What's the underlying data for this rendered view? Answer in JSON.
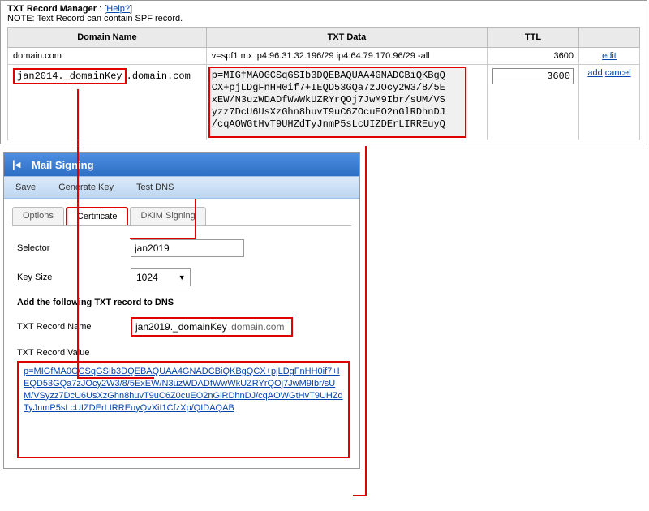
{
  "topPanel": {
    "titleBold": "TXT Record Manager",
    "helpLabel": "Help?",
    "note": "NOTE: Text Record can contain SPF record."
  },
  "table": {
    "headers": {
      "domain": "Domain Name",
      "txtdata": "TXT Data",
      "ttl": "TTL",
      "actions": ""
    },
    "row1": {
      "domain": "domain.com",
      "txtdata": "v=spf1 mx ip4:96.31.32.196/29 ip4:64.79.170.96/29 -all",
      "ttl": "3600",
      "action": "edit"
    },
    "row2": {
      "domainPrefix": "jan2014._domainKey",
      "domainSuffix": ".domain.com",
      "txtdata_l1": "p=MIGfMAOGCSqGSIb3DQEBAQUAA4GNADCBiQKBgQ",
      "txtdata_l2": "CX+pjLDgFnHH0if7+IEQD53GQa7zJOcy2W3/8/5E",
      "txtdata_l3": "xEW/N3uzWDADfWwWkUZRYrQOj7JwM9Ibr/sUM/VS",
      "txtdata_l4": "yzz7DcU6UsXzGhn8huvT9uC6ZOcuEO2nGlRDhnDJ",
      "txtdata_l5": "/cqAOWGtHvT9UHZdTyJnmP5sLcUIZDErLIRREuyQ",
      "ttl": "3600",
      "action_add": "add",
      "action_cancel": "cancel"
    }
  },
  "mailWin": {
    "title": "Mail Signing",
    "toolbar": {
      "save": "Save",
      "generate": "Generate Key",
      "test": "Test DNS"
    },
    "tabs": {
      "options": "Options",
      "certificate": "Certificate",
      "dkim": "DKIM Signing"
    },
    "form": {
      "selectorLabel": "Selector",
      "selectorValue": "jan2019",
      "keySizeLabel": "Key Size",
      "keySizeValue": "1024",
      "sectionHead": "Add the following TXT record to DNS",
      "txtNameLabel": "TXT Record Name",
      "txtNamePrefix": "jan2019._domainKey",
      "txtNameSuffix": ".domain.com",
      "txtValueLabel": "TXT Record Value",
      "txtValue": "p=MIGfMA0GCSqGSIb3DQEBAQUAA4GNADCBiQKBgQCX+pjLDgFnHH0if7+IEQD53GQa7zJOcy2W3/8/5ExEW/N3uzWDADfWwWkUZRYrQOj7JwM9Ibr/sUM/VSyzz7DcU6UsXzGhn8huvT9uC6Z0cuEO2nGlRDhnDJ/cqAOWGtHvT9UHZdTyJnmP5sLcUIZDErLIRREuyQvXiI1CfzXp/QIDAQAB"
    }
  }
}
